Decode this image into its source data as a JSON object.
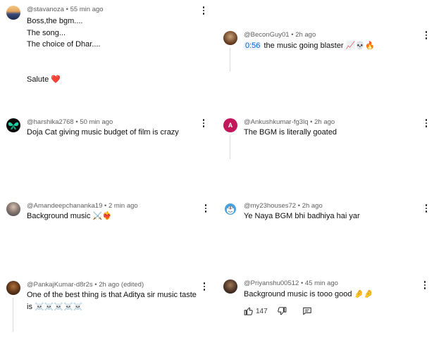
{
  "comments": [
    {
      "handle": "@stavanoza",
      "time": "55 min ago",
      "lines": [
        "Boss,the bgm....",
        "The song...",
        "The choice of Dhar....",
        "",
        "",
        "Salute"
      ],
      "emoji": "❤️"
    },
    {
      "handle": "@BeconGuy01",
      "time": "2h ago",
      "timestamp": "0:56",
      "text": "the music going blaster",
      "emoji": "📈💀🔥"
    },
    {
      "handle": "@harshika2768",
      "time": "50 min ago",
      "text": "Doja Cat giving music budget of film is crazy"
    },
    {
      "handle": "@Ankushkumar-fg3lq",
      "time": "2h ago",
      "text": "The BGM is literally goated",
      "avatar_letter": "A"
    },
    {
      "handle": "@Amandeepchananka19",
      "time": "2 min ago",
      "text": "Background music",
      "emoji": "⚔️❤️‍🔥"
    },
    {
      "handle": "@my23houses72",
      "time": "2h ago",
      "text": "Ye Naya BGM bhi badhiya hai yar"
    },
    {
      "handle": "@PankajKumar-d8r2s",
      "time": "2h ago (edited)",
      "lines": [
        "One of the best thing is that Aditya sir music taste",
        "is"
      ],
      "emoji": "☠️☠️☠️☠️☠️"
    },
    {
      "handle": "@Priyanshu00512",
      "time": "45 min ago",
      "text": "Background music is tooo good",
      "emoji": "🤌🤌",
      "like_count": "147"
    }
  ],
  "separator": " • ",
  "colors": {
    "meta_text": "#606060",
    "body_text": "#0f0f0f",
    "timestamp_link": "#065fd4",
    "letter_avatar_bg": "#c2185b"
  },
  "icons": [
    "more-vert-icon",
    "like-icon",
    "dislike-icon",
    "reply-icon"
  ]
}
